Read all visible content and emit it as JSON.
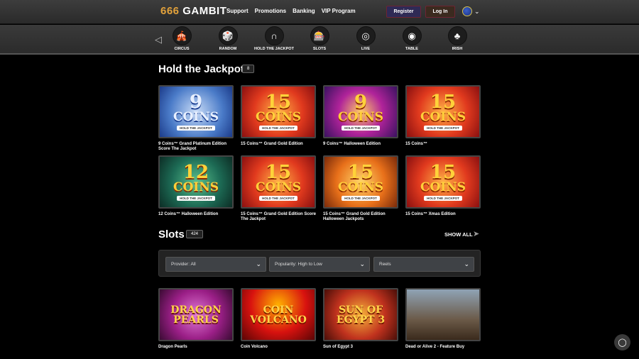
{
  "header": {
    "logo_num": "666",
    "logo_word": "GAMBIT",
    "nav": [
      "Support",
      "Promotions",
      "Banking",
      "VIP Program"
    ],
    "register_label": "Register",
    "login_label": "Log In"
  },
  "categories": [
    {
      "label": "CIRCUS",
      "icon": "circus-icon",
      "glyph": "🎪"
    },
    {
      "label": "RANDOM",
      "icon": "random-icon",
      "glyph": "🎲"
    },
    {
      "label": "HOLD THE JACKPOT",
      "icon": "horseshoe-icon",
      "glyph": "∩"
    },
    {
      "label": "SLOTS",
      "icon": "slots-icon",
      "glyph": "🎰"
    },
    {
      "label": "LIVE",
      "icon": "roulette-icon",
      "glyph": "◎"
    },
    {
      "label": "TABLE",
      "icon": "chip-icon",
      "glyph": "◉"
    },
    {
      "label": "IRISH",
      "icon": "clover-icon",
      "glyph": "♣"
    }
  ],
  "jackpot_section": {
    "title": "Hold the Jackpot",
    "count": "8",
    "games": [
      {
        "name": "9 Coins™ Grand Platinum Edition Score The Jackpot",
        "num": "9",
        "theme": "t-platinum"
      },
      {
        "name": "15 Coins™ Grand Gold Edition",
        "num": "15",
        "theme": "t-red"
      },
      {
        "name": "9 Coins™ Halloween Edition",
        "num": "9",
        "theme": "t-purple"
      },
      {
        "name": "15 Coins™",
        "num": "15",
        "theme": "t-red"
      },
      {
        "name": "12 Coins™ Halloween Edition",
        "num": "12",
        "theme": "t-green"
      },
      {
        "name": "15 Coins™ Grand Gold Edition Score The Jackpot",
        "num": "15",
        "theme": "t-red"
      },
      {
        "name": "15 Coins™ Grand Gold Edition Halloween Jackpots",
        "num": "15",
        "theme": "t-orange"
      },
      {
        "name": "15 Coins™ Xmas Edition",
        "num": "15",
        "theme": "t-red"
      }
    ]
  },
  "slots_section": {
    "title": "Slots",
    "count": "424",
    "show_all": "SHOW ALL",
    "filters": {
      "provider": "Provider: All",
      "sort": "Popularity: High to Low",
      "type": "Reels"
    },
    "games": [
      {
        "name": "Dragon Pearls",
        "art": "DRAGON PEARLS",
        "theme": "t-dragon"
      },
      {
        "name": "Coin Volcano",
        "art": "COIN VOLCANO",
        "theme": "t-volcano"
      },
      {
        "name": "Sun of Egypt 3",
        "art": "SUN OF EGYPT 3",
        "theme": "t-egypt"
      },
      {
        "name": "Dead or Alive 2 - Feature Buy",
        "art": "",
        "theme": "t-doa"
      }
    ]
  },
  "coin_tile": {
    "coins_word": "COINS",
    "sub": "HOLD THE JACKPOT"
  }
}
